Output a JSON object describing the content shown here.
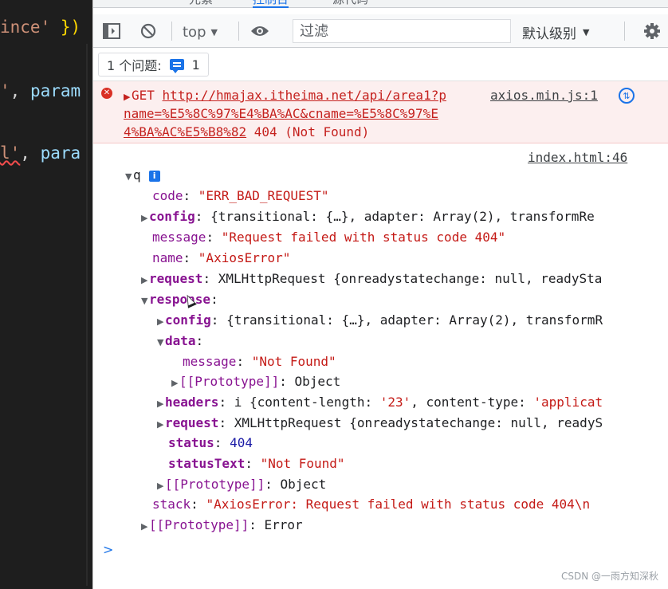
{
  "editor": {
    "line1": {
      "str": "ince'",
      "brace": " }",
      "close": ")"
    },
    "line2": {
      "str": "'",
      "punc": ",",
      "id": " param"
    },
    "line3": {
      "str": "l'",
      "punc": ",",
      "id": " para"
    }
  },
  "devtools": {
    "tabs": [
      "元素",
      "控制台",
      "源代码"
    ],
    "toolbar": {
      "context": "top",
      "filter_placeholder": "过滤",
      "levels": "默认级别"
    },
    "issues": {
      "label": "1 个问题:",
      "count": "1"
    },
    "error": {
      "method": "GET",
      "url_part1": "http://hmajax.itheima.net/api/area1?p",
      "url_part2": "name=%E5%8C%97%E4%BA%AC&cname=%E5%8C%97%E",
      "url_part3": "4%BA%AC%E5%B8%82",
      "status": " 404 (Not Found)",
      "source": "axios.min.js:1"
    },
    "log_source": "index.html:46",
    "tree": {
      "root": "q",
      "code_key": "code",
      "code_val": "\"ERR_BAD_REQUEST\"",
      "config_key": "config",
      "config_val": "{transitional: {…}, adapter: Array(2), transformRe",
      "message_key": "message",
      "message_val": "\"Request failed with status code 404\"",
      "name_key": "name",
      "name_val": "\"AxiosError\"",
      "request_key": "request",
      "request_val": "XMLHttpRequest {onreadystatechange: null, readySta",
      "response_key": "response",
      "resp_config_key": "config",
      "resp_config_val": "{transitional: {…}, adapter: Array(2), transformR",
      "data_key": "data",
      "data_message_key": "message",
      "data_message_val": "\"Not Found\"",
      "data_proto_key": "[[Prototype]]",
      "data_proto_val": "Object",
      "headers_key": "headers",
      "headers_prefix": "i {content-length: ",
      "headers_len": "'23'",
      "headers_mid": ", content-type: ",
      "headers_type": "'applicat",
      "resp_request_key": "request",
      "resp_request_val": "XMLHttpRequest {onreadystatechange: null, readyS",
      "status_key": "status",
      "status_val": "404",
      "statustext_key": "statusText",
      "statustext_val": "\"Not Found\"",
      "resp_proto_key": "[[Prototype]]",
      "resp_proto_val": "Object",
      "stack_key": "stack",
      "stack_val": "\"AxiosError: Request failed with status code 404\\n",
      "root_proto_key": "[[Prototype]]",
      "root_proto_val": "Error"
    },
    "prompt": ">"
  },
  "watermark": "CSDN @一雨方知深秋",
  "icons": [
    "sidebar-toggle-icon",
    "clear-console-icon",
    "eye-icon",
    "gear-icon",
    "error-icon",
    "info-icon",
    "network-icon",
    "issue-icon",
    "mouse-cursor-icon"
  ]
}
